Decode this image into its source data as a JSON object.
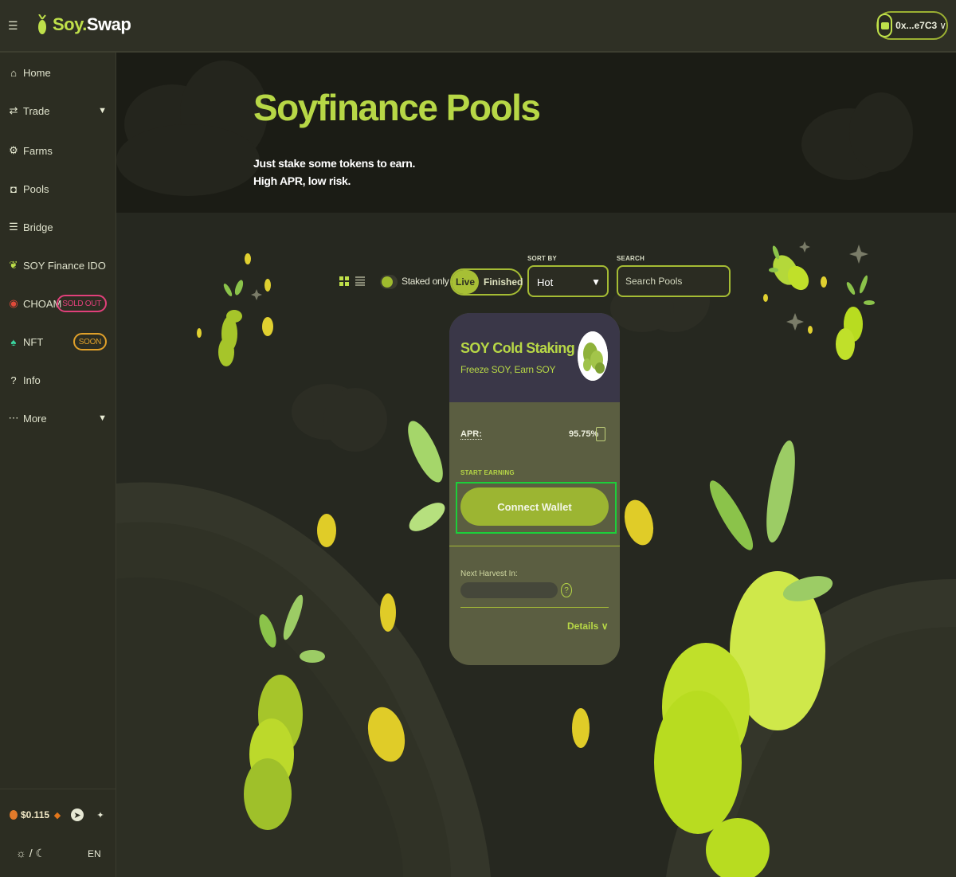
{
  "app": {
    "logo_part1": "Soy",
    "logo_part2": "Swap",
    "wallet_address": "0x...e7C3",
    "accent": "#b7d746",
    "highlight_outline": "#1ccf3a"
  },
  "sidebar": {
    "items": [
      {
        "label": "Home",
        "icon": "home-icon"
      },
      {
        "label": "Trade",
        "icon": "swap-icon"
      },
      {
        "label": "Farms",
        "icon": "tractor-icon"
      },
      {
        "label": "Pools",
        "icon": "jar-icon"
      },
      {
        "label": "Bridge",
        "icon": "bridge-icon"
      },
      {
        "label": "SOY Finance IDO",
        "icon": "soy-icon"
      },
      {
        "label": "CHOAM",
        "icon": "choam-icon",
        "badge": "SOLD OUT"
      },
      {
        "label": "NFT",
        "icon": "nft-icon",
        "badge": "SOON"
      },
      {
        "label": "Info",
        "icon": "question-icon"
      },
      {
        "label": "More",
        "icon": "dots-icon"
      }
    ],
    "footer": {
      "price": "$0.115",
      "theme_toggle": "☼ / ☾",
      "language": "EN"
    }
  },
  "hero": {
    "title": "Soyfinance Pools",
    "subtitle_line1": "Just stake some tokens to earn.",
    "subtitle_line2": "High APR, low risk."
  },
  "controls": {
    "staked_only_label": "Staked only",
    "live_label": "Live",
    "finished_label": "Finished",
    "sort_label": "SORT BY",
    "sort_value": "Hot",
    "search_label": "SEARCH",
    "search_placeholder": "Search Pools"
  },
  "card": {
    "title": "SOY Cold Staking",
    "subtitle": "Freeze SOY, Earn SOY",
    "apr_label": "APR:",
    "apr_value": "95.75%",
    "start_earning_label": "START EARNING",
    "connect_button": "Connect Wallet",
    "next_harvest_label": "Next Harvest In:",
    "details_label": "Details"
  }
}
